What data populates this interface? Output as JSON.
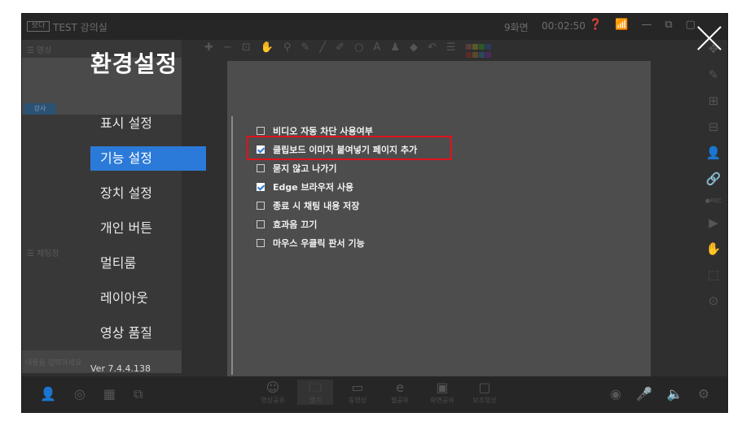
{
  "topbar": {
    "logo": "보다",
    "room_name": "TEST 강의실",
    "screen_count": "9화면",
    "timer": "00:02:50",
    "icons": [
      "help-icon",
      "wifi-icon",
      "minimize-icon",
      "restore-icon",
      "maximize-icon"
    ]
  },
  "left_panel": {
    "video_label": "☰ 영상",
    "video_tag": "강사",
    "chat_label": "☰ 채팅창",
    "chat_placeholder": "내용을 입력하세요"
  },
  "settings": {
    "title": "환경설정",
    "menu": [
      {
        "label": "표시 설정",
        "active": false
      },
      {
        "label": "기능 설정",
        "active": true
      },
      {
        "label": "장치 설정",
        "active": false
      },
      {
        "label": "개인 버튼",
        "active": false
      },
      {
        "label": "멀티룸",
        "active": false
      },
      {
        "label": "레이아웃",
        "active": false
      },
      {
        "label": "영상 품질",
        "active": false
      }
    ],
    "version": "Ver 7.4.4.138",
    "options": [
      {
        "label": "비디오 자동 차단 사용여부",
        "checked": false
      },
      {
        "label": "클립보드 이미지 붙여넣기 페이지 추가",
        "checked": true,
        "highlighted": true
      },
      {
        "label": "묻지 않고 나가기",
        "checked": false
      },
      {
        "label": "Edge 브라우저 사용",
        "checked": true
      },
      {
        "label": "종료 시 채팅 내용 저장",
        "checked": false
      },
      {
        "label": "효과음 끄기",
        "checked": false
      },
      {
        "label": "마우스 우클릭 판서 기능",
        "checked": false
      }
    ]
  },
  "bottombar": {
    "center_items": [
      {
        "icon": "smile-icon",
        "label": "영상공유"
      },
      {
        "icon": "folder-icon",
        "label": "열기"
      },
      {
        "icon": "video-icon",
        "label": "동영상"
      },
      {
        "icon": "browser-icon",
        "label": "웹공유"
      },
      {
        "icon": "screen-share-icon",
        "label": "화면공유"
      },
      {
        "icon": "board-icon",
        "label": "보조영상"
      }
    ]
  },
  "colors": {
    "accent": "#2b7ad9",
    "highlight_border": "#e0121b",
    "panel_bg": "#4d4d4d",
    "frame_bg": "#2f2f2f"
  }
}
